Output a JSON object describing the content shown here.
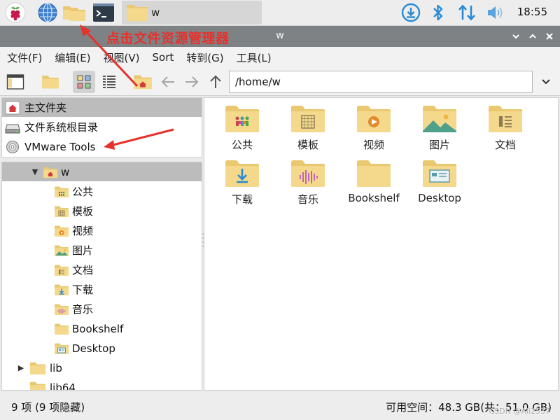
{
  "taskbar": {
    "task_label": "w",
    "clock": "18:55",
    "icons": [
      "raspberry-menu-icon",
      "browser-globe-icon",
      "file-manager-icon",
      "terminal-icon"
    ],
    "tray_icons": [
      "update-download-icon",
      "bluetooth-icon",
      "network-arrows-icon",
      "volume-icon"
    ]
  },
  "annotation": {
    "text": "点击文件资源管理器",
    "color": "#e5322d"
  },
  "window": {
    "title": "w"
  },
  "menubar": {
    "items": [
      "文件(F)",
      "编辑(E)",
      "视图(V)",
      "Sort",
      "转到(G)",
      "工具(L)"
    ]
  },
  "toolbar": {
    "path_value": "/home/w"
  },
  "places": {
    "items": [
      "主文件夹",
      "文件系统根目录",
      "VMware Tools"
    ]
  },
  "tree": {
    "root": "w",
    "children": [
      "公共",
      "模板",
      "视频",
      "图片",
      "文档",
      "下载",
      "音乐",
      "Bookshelf",
      "Desktop"
    ],
    "siblings": [
      "lib",
      "lib64"
    ]
  },
  "files": [
    "公共",
    "模板",
    "视频",
    "图片",
    "文档",
    "下载",
    "音乐",
    "Bookshelf",
    "Desktop"
  ],
  "status": {
    "left": "9 项 (9 项隐藏)",
    "right": "可用空间：48.3 GB(共：51.0 GB)",
    "watermark": "CSDN @Ali2537"
  },
  "colors": {
    "folder": "#f4d98c",
    "folder_dark": "#e9c870",
    "selection": "#bcbcbc",
    "titlebar": "#7f8284",
    "accent_blue": "#2a8ad6"
  }
}
